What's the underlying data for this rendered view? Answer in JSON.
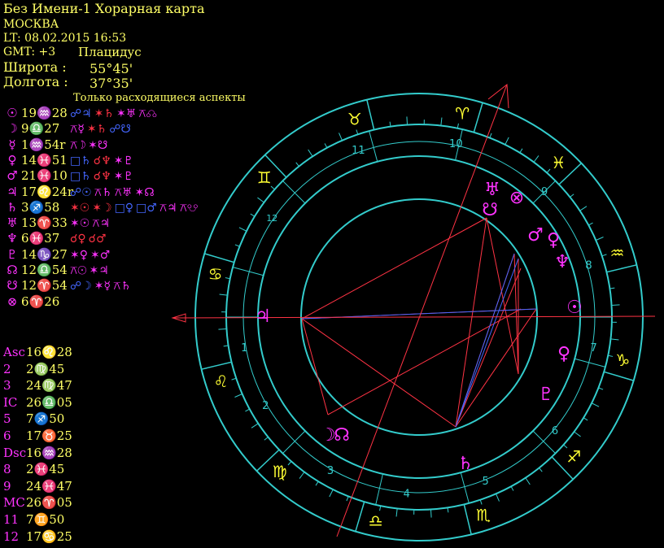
{
  "header": {
    "title": "Без Имени-1 Хорарная карта",
    "city": "МОСКВА",
    "lt": "LT: 08.02.2015  16:53",
    "gmt": "GMT: +3",
    "house_system": "Плацидус",
    "lat_label": "Широта :",
    "lat_value": "55°45'",
    "lon_label": "Долгота :",
    "lon_value": "37°35'"
  },
  "aspects_title": "Только расходящиеся аспекты",
  "planets": [
    {
      "glyph": "☉",
      "pos": "19♒28",
      "aspects": [
        {
          "t": "☍♃",
          "c": "#4466ff"
        },
        {
          "t": "✶♄",
          "c": "#ff3344"
        },
        {
          "t": "✶♅",
          "c": "#ff33ff"
        },
        {
          "t": "⚻☊",
          "c": "#ff33ff"
        }
      ]
    },
    {
      "glyph": "☽",
      "pos": "9♎27",
      "aspects": [
        {
          "t": "⚻☿",
          "c": "#ff33ff"
        },
        {
          "t": "✶♄",
          "c": "#ff3344"
        },
        {
          "t": "☍☋",
          "c": "#4466ff"
        }
      ]
    },
    {
      "glyph": "☿",
      "pos": "1♒54r",
      "aspects": [
        {
          "t": "⚻☽",
          "c": "#ff33ff"
        },
        {
          "t": "✶☋",
          "c": "#ff33ff"
        }
      ]
    },
    {
      "glyph": "♀",
      "pos": "14♓51",
      "aspects": [
        {
          "t": "□♄",
          "c": "#4466ff"
        },
        {
          "t": "☌♆",
          "c": "#ff3344"
        },
        {
          "t": "✶♇",
          "c": "#ff33ff"
        }
      ]
    },
    {
      "glyph": "♂",
      "pos": "21♓10",
      "aspects": [
        {
          "t": "□♄",
          "c": "#4466ff"
        },
        {
          "t": "☌♆",
          "c": "#ff3344"
        },
        {
          "t": "✶♇",
          "c": "#ff33ff"
        }
      ]
    },
    {
      "glyph": "♃",
      "pos": "17♌24r",
      "aspects": [
        {
          "t": "☍☉",
          "c": "#4466ff"
        },
        {
          "t": "⚻♄",
          "c": "#ff33ff"
        },
        {
          "t": "⚻♅",
          "c": "#ff33ff"
        },
        {
          "t": "✶☊",
          "c": "#ff33ff"
        }
      ]
    },
    {
      "glyph": "♄",
      "pos": "3♐58",
      "aspects": [
        {
          "t": "✶☉",
          "c": "#ff3344"
        },
        {
          "t": "✶☽",
          "c": "#ff3344"
        },
        {
          "t": "□♀",
          "c": "#4466ff"
        },
        {
          "t": "□♂",
          "c": "#4466ff"
        },
        {
          "t": "⚻♃",
          "c": "#ff33ff"
        },
        {
          "t": "⚻☋",
          "c": "#ff33ff"
        }
      ]
    },
    {
      "glyph": "♅",
      "pos": "13♈33",
      "aspects": [
        {
          "t": "✶☉",
          "c": "#ff33ff"
        },
        {
          "t": "⚻♃",
          "c": "#ff33ff"
        }
      ]
    },
    {
      "glyph": "♆",
      "pos": "6♓37",
      "aspects": [
        {
          "t": "☌♀",
          "c": "#ff3344"
        },
        {
          "t": "☌♂",
          "c": "#ff3344"
        }
      ]
    },
    {
      "glyph": "♇",
      "pos": "14♑27",
      "aspects": [
        {
          "t": "✶♀",
          "c": "#ff33ff"
        },
        {
          "t": "✶♂",
          "c": "#ff33ff"
        }
      ]
    },
    {
      "glyph": "☊",
      "pos": "12♎54",
      "aspects": [
        {
          "t": "⚻☉",
          "c": "#ff33ff"
        },
        {
          "t": "✶♃",
          "c": "#ff33ff"
        }
      ]
    },
    {
      "glyph": "☋",
      "pos": "12♈54",
      "aspects": [
        {
          "t": "☍☽",
          "c": "#4466ff"
        },
        {
          "t": "✶☿",
          "c": "#ff33ff"
        },
        {
          "t": "⚻♄",
          "c": "#ff33ff"
        }
      ]
    },
    {
      "glyph": "⊗",
      "pos": "6♈26",
      "aspects": []
    }
  ],
  "cusps": [
    {
      "label": "Asc",
      "pos": "16♌28"
    },
    {
      "label": "2",
      "pos": "2♍45"
    },
    {
      "label": "3",
      "pos": "24♍47"
    },
    {
      "label": "IC",
      "pos": "26♎05"
    },
    {
      "label": "5",
      "pos": "7♐50"
    },
    {
      "label": "6",
      "pos": "17♉25"
    },
    {
      "label": "Dsc",
      "pos": "16♒28"
    },
    {
      "label": "8",
      "pos": "2♓45"
    },
    {
      "label": "9",
      "pos": "24♓47"
    },
    {
      "label": "MC",
      "pos": "26♈05"
    },
    {
      "label": "11",
      "pos": "7♊50"
    },
    {
      "label": "12",
      "pos": "17♋25"
    }
  ],
  "wheel": {
    "house_numbers": [
      "1",
      "2",
      "3",
      "4",
      "5",
      "6",
      "7",
      "8",
      "9",
      "10",
      "11",
      "12"
    ],
    "signs": [
      {
        "name": "taurus-glyph",
        "glyph": "♉"
      },
      {
        "name": "aries-glyph",
        "glyph": "♈"
      },
      {
        "name": "pisces-glyph",
        "glyph": "♓"
      },
      {
        "name": "aquarius-glyph",
        "glyph": "♒"
      },
      {
        "name": "capricorn-glyph",
        "glyph": "♑"
      },
      {
        "name": "sagittarius-glyph",
        "glyph": "♐"
      },
      {
        "name": "scorpio-glyph",
        "glyph": "♏"
      },
      {
        "name": "libra-glyph",
        "glyph": "♎"
      },
      {
        "name": "virgo-glyph",
        "glyph": "♍"
      },
      {
        "name": "leo-glyph",
        "glyph": "♌"
      },
      {
        "name": "cancer-glyph",
        "glyph": "♋"
      },
      {
        "name": "gemini-glyph",
        "glyph": "♊"
      }
    ],
    "bodies": [
      {
        "name": "jupiter-glyph",
        "glyph": "♃"
      },
      {
        "name": "moon-glyph",
        "glyph": "☽"
      },
      {
        "name": "north-node-glyph",
        "glyph": "☊"
      },
      {
        "name": "saturn-glyph",
        "glyph": "♄"
      },
      {
        "name": "pluto-glyph",
        "glyph": "♇"
      },
      {
        "name": "venus-glyph",
        "glyph": "♀"
      },
      {
        "name": "sun-glyph",
        "glyph": "☉"
      },
      {
        "name": "neptune-glyph",
        "glyph": "♆"
      },
      {
        "name": "mars-glyph",
        "glyph": "♂"
      },
      {
        "name": "venus-glyph",
        "glyph": "♀"
      },
      {
        "name": "south-node-glyph",
        "glyph": "☋"
      },
      {
        "name": "uranus-glyph",
        "glyph": "♅"
      },
      {
        "name": "fortune-glyph",
        "glyph": "⊗"
      }
    ]
  },
  "colors": {
    "background": "#000000",
    "ring": "#33cccc",
    "text_yellow": "#ffff66",
    "glyph_magenta": "#ff33ff",
    "aspect_red": "#ff3344",
    "aspect_blue": "#4466ff",
    "sign_yellow": "#ffff33"
  }
}
